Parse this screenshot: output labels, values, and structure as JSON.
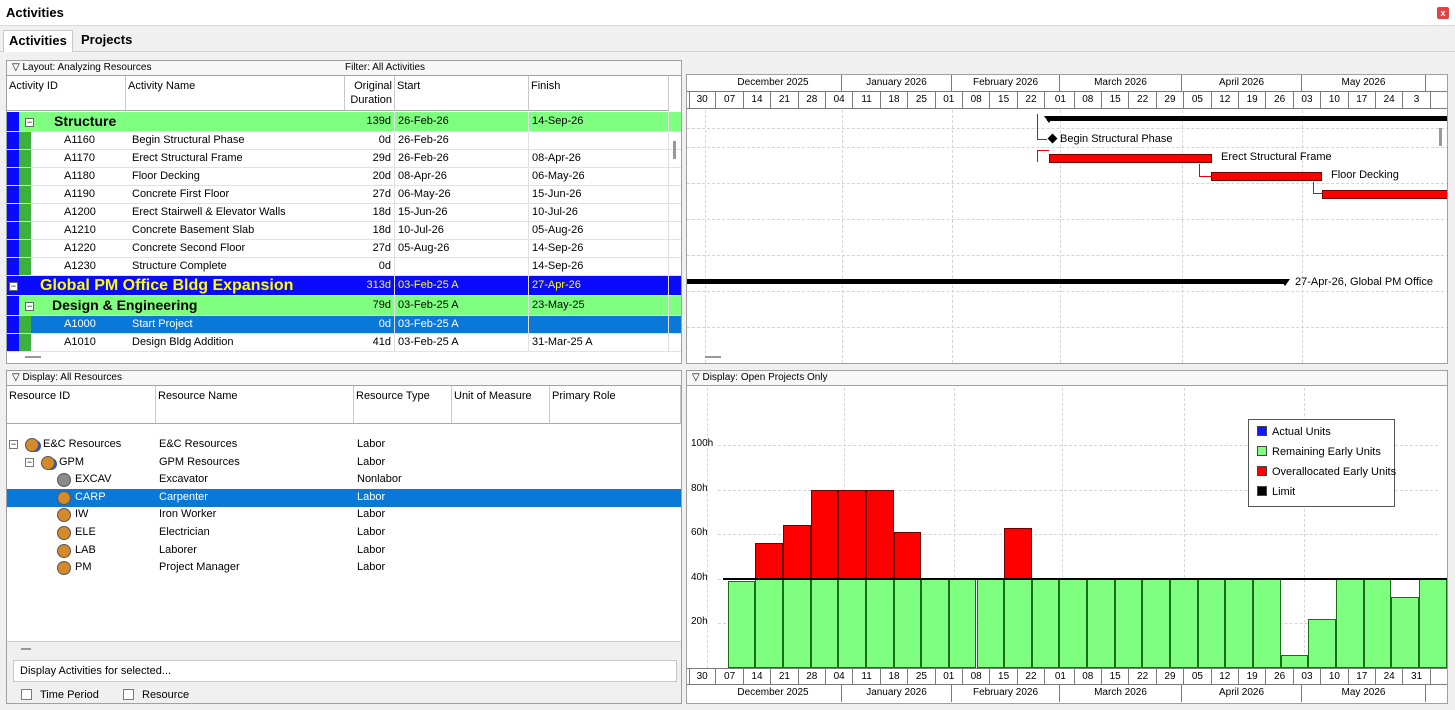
{
  "window": {
    "title": "Activities",
    "close_glyph": "x"
  },
  "tabs": [
    "Activities",
    "Projects"
  ],
  "activities_panel": {
    "layout_label": "Layout: Analyzing Resources",
    "filter_label": "Filter: All Activities",
    "columns": {
      "id": "Activity ID",
      "name": "Activity Name",
      "dur1": "Original",
      "dur2": "Duration",
      "start": "Start",
      "finish": "Finish"
    },
    "rows": [
      {
        "kind": "wbs1",
        "id": "",
        "name": "Structure",
        "dur": "139d",
        "start": "26-Feb-26",
        "finish": "14-Sep-26"
      },
      {
        "kind": "act",
        "id": "A1160",
        "name": "Begin Structural Phase",
        "dur": "0d",
        "start": "26-Feb-26",
        "finish": ""
      },
      {
        "kind": "act",
        "id": "A1170",
        "name": "Erect Structural Frame",
        "dur": "29d",
        "start": "26-Feb-26",
        "finish": "08-Apr-26"
      },
      {
        "kind": "act",
        "id": "A1180",
        "name": "Floor Decking",
        "dur": "20d",
        "start": "08-Apr-26",
        "finish": "06-May-26"
      },
      {
        "kind": "act",
        "id": "A1190",
        "name": "Concrete First Floor",
        "dur": "27d",
        "start": "06-May-26",
        "finish": "15-Jun-26"
      },
      {
        "kind": "act",
        "id": "A1200",
        "name": "Erect Stairwell & Elevator Walls",
        "dur": "18d",
        "start": "15-Jun-26",
        "finish": "10-Jul-26"
      },
      {
        "kind": "act",
        "id": "A1210",
        "name": "Concrete Basement Slab",
        "dur": "18d",
        "start": "10-Jul-26",
        "finish": "05-Aug-26"
      },
      {
        "kind": "act",
        "id": "A1220",
        "name": "Concrete Second Floor",
        "dur": "27d",
        "start": "05-Aug-26",
        "finish": "14-Sep-26"
      },
      {
        "kind": "act",
        "id": "A1230",
        "name": "Structure Complete",
        "dur": "0d",
        "start": "",
        "finish": "14-Sep-26"
      },
      {
        "kind": "proj",
        "id": "",
        "name": "Global PM Office Bldg Expansion",
        "dur": "313d",
        "start": "03-Feb-25 A",
        "finish": "27-Apr-26"
      },
      {
        "kind": "wbs2",
        "id": "",
        "name": "Design & Engineering",
        "dur": "79d",
        "start": "03-Feb-25 A",
        "finish": "23-May-25"
      },
      {
        "kind": "sel",
        "id": "A1000",
        "name": "Start Project",
        "dur": "0d",
        "start": "03-Feb-25 A",
        "finish": ""
      },
      {
        "kind": "act",
        "id": "A1010",
        "name": "Design Bldg Addition",
        "dur": "41d",
        "start": "03-Feb-25 A",
        "finish": "31-Mar-25 A"
      }
    ]
  },
  "timescale": {
    "months": [
      "December 2025",
      "January 2026",
      "February 2026",
      "March 2026",
      "April 2026",
      "May 2026"
    ],
    "days": [
      "3",
      "30",
      "07",
      "14",
      "21",
      "28",
      "04",
      "11",
      "18",
      "25",
      "01",
      "08",
      "15",
      "22",
      "01",
      "08",
      "15",
      "22",
      "29",
      "05",
      "12",
      "19",
      "26",
      "03",
      "10",
      "17",
      "24",
      "3"
    ],
    "days_bottom": [
      "3",
      "30",
      "07",
      "14",
      "21",
      "28",
      "04",
      "11",
      "18",
      "25",
      "01",
      "08",
      "15",
      "22",
      "01",
      "08",
      "15",
      "22",
      "29",
      "05",
      "12",
      "19",
      "26",
      "03",
      "10",
      "17",
      "24",
      "31"
    ]
  },
  "gantt_labels": {
    "begin": "Begin Structural Phase",
    "erect": "Erect Structural Frame",
    "floor": "Floor Decking",
    "project": "27-Apr-26, Global PM Office"
  },
  "resources_panel": {
    "display_label": "Display: All Resources",
    "columns": {
      "id": "Resource ID",
      "name": "Resource Name",
      "type": "Resource Type",
      "uom": "Unit of Measure",
      "role": "Primary Role"
    },
    "rows": [
      {
        "id": "E&C Resources",
        "name": "E&C Resources",
        "type": "Labor",
        "level": 0,
        "icon": "person-group-icon"
      },
      {
        "id": "GPM",
        "name": "GPM Resources",
        "type": "Labor",
        "level": 1,
        "icon": "person-group-icon"
      },
      {
        "id": "EXCAV",
        "name": "Excavator",
        "type": "Nonlabor",
        "level": 2,
        "icon": "gear-icon"
      },
      {
        "id": "CARP",
        "name": "Carpenter",
        "type": "Labor",
        "level": 2,
        "icon": "person-icon"
      },
      {
        "id": "IW",
        "name": "Iron Worker",
        "type": "Labor",
        "level": 2,
        "icon": "person-icon"
      },
      {
        "id": "ELE",
        "name": "Electrician",
        "type": "Labor",
        "level": 2,
        "icon": "person-icon"
      },
      {
        "id": "LAB",
        "name": "Laborer",
        "type": "Labor",
        "level": 2,
        "icon": "person-icon"
      },
      {
        "id": "PM",
        "name": "Project Manager",
        "type": "Labor",
        "level": 2,
        "icon": "person-icon"
      }
    ],
    "display_for_selected": "Display Activities for selected...",
    "time_period": "Time Period",
    "resource": "Resource"
  },
  "profile_panel": {
    "display_label": "Display: Open Projects Only",
    "y_labels": [
      "100h",
      "80h",
      "60h",
      "40h",
      "20h"
    ],
    "legend": [
      {
        "label": "Actual Units",
        "color": "#1414ff"
      },
      {
        "label": "Remaining Early Units",
        "color": "#7fff7f"
      },
      {
        "label": "Overallocated Early Units",
        "color": "#ff0000"
      },
      {
        "label": "Limit",
        "color": "#000000"
      }
    ]
  },
  "chart_data": {
    "type": "bar",
    "categories": [
      "30",
      "07",
      "14",
      "21",
      "28",
      "04",
      "11",
      "18",
      "25",
      "01",
      "08",
      "15",
      "22",
      "01",
      "08",
      "15",
      "22",
      "29",
      "05",
      "12",
      "19",
      "26",
      "03",
      "10",
      "17",
      "24",
      "31"
    ],
    "series": [
      {
        "name": "Remaining Early Units",
        "values": [
          0,
          39,
          40,
          40,
          40,
          40,
          40,
          40,
          40,
          40,
          40,
          40,
          40,
          40,
          40,
          40,
          40,
          40,
          40,
          40,
          40,
          6,
          22,
          40,
          40,
          32,
          40
        ]
      },
      {
        "name": "Overallocated Early Units",
        "values": [
          0,
          0,
          16,
          24,
          40,
          40,
          40,
          21,
          0,
          0,
          0,
          23,
          0,
          0,
          0,
          0,
          0,
          0,
          0,
          0,
          0,
          0,
          0,
          0,
          0,
          0,
          0
        ]
      },
      {
        "name": "Limit",
        "values": [
          40
        ]
      }
    ],
    "ylim": [
      0,
      110
    ],
    "xlabel": "",
    "ylabel": "",
    "grid": true,
    "legend": "top-right"
  }
}
